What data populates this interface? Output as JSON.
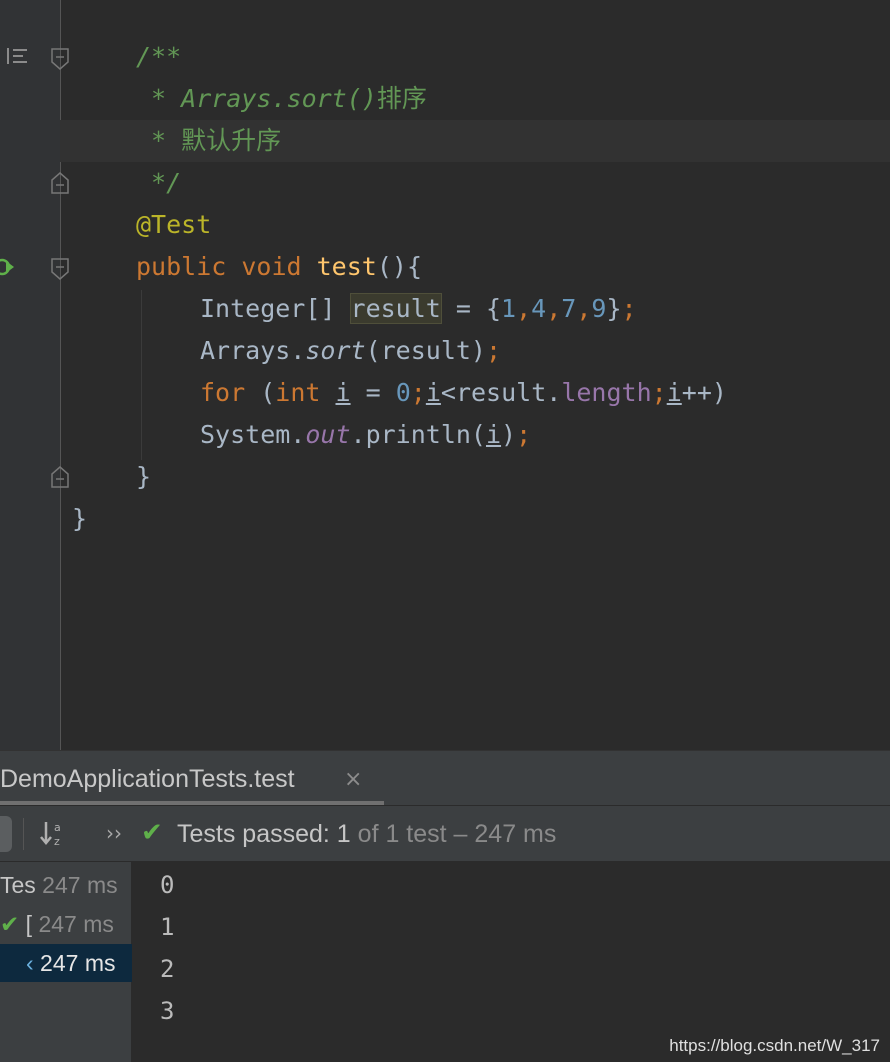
{
  "editor": {
    "lines": [
      {
        "id": "l1",
        "tokens": [
          {
            "t": "/**",
            "c": "cmt"
          }
        ]
      },
      {
        "id": "l2",
        "tokens": [
          {
            "t": " * Arrays.sort()",
            "c": "cmt"
          },
          {
            "t": "排序",
            "c": "cmt-cn"
          }
        ]
      },
      {
        "id": "l3",
        "tokens": [
          {
            "t": " * ",
            "c": "cmt"
          },
          {
            "t": "默认升序",
            "c": "cmt-cn"
          }
        ]
      },
      {
        "id": "l4",
        "tokens": [
          {
            "t": " */",
            "c": "cmt"
          }
        ]
      },
      {
        "id": "l5",
        "tokens": [
          {
            "t": "@Test",
            "c": "ann"
          }
        ]
      },
      {
        "id": "l6",
        "tokens": [
          {
            "t": "public ",
            "c": "kw"
          },
          {
            "t": "void ",
            "c": "kw"
          },
          {
            "t": "test",
            "c": "fn"
          },
          {
            "t": "(){",
            "c": ""
          }
        ]
      },
      {
        "id": "l7",
        "tokens": [
          {
            "t": "Integer[] ",
            "c": ""
          },
          {
            "t": "result",
            "c": "hl"
          },
          {
            "t": " = {",
            "c": ""
          },
          {
            "t": "1",
            "c": "num"
          },
          {
            "t": ",",
            "c": "semi"
          },
          {
            "t": "4",
            "c": "num"
          },
          {
            "t": ",",
            "c": "semi"
          },
          {
            "t": "7",
            "c": "num"
          },
          {
            "t": ",",
            "c": "semi"
          },
          {
            "t": "9",
            "c": "num"
          },
          {
            "t": "}",
            "c": ""
          },
          {
            "t": ";",
            "c": "semi"
          }
        ]
      },
      {
        "id": "l8",
        "tokens": [
          {
            "t": "Arrays.",
            "c": ""
          },
          {
            "t": "sort",
            "c": "ital"
          },
          {
            "t": "(result)",
            "c": ""
          },
          {
            "t": ";",
            "c": "semi"
          }
        ]
      },
      {
        "id": "l9",
        "tokens": [
          {
            "t": "for ",
            "c": "kw"
          },
          {
            "t": "(",
            "c": ""
          },
          {
            "t": "int ",
            "c": "kw"
          },
          {
            "t": "i",
            "c": "ul"
          },
          {
            "t": " = ",
            "c": ""
          },
          {
            "t": "0",
            "c": "num"
          },
          {
            "t": ";",
            "c": "semi"
          },
          {
            "t": "i",
            "c": "ul"
          },
          {
            "t": "<result.",
            "c": ""
          },
          {
            "t": "length",
            "c": "fld"
          },
          {
            "t": ";",
            "c": "semi"
          },
          {
            "t": "i",
            "c": "ul"
          },
          {
            "t": "++)",
            "c": ""
          }
        ]
      },
      {
        "id": "l10",
        "tokens": [
          {
            "t": "System.",
            "c": ""
          },
          {
            "t": "out",
            "c": "ital-fld"
          },
          {
            "t": ".println(",
            "c": ""
          },
          {
            "t": "i",
            "c": "ul"
          },
          {
            "t": ")",
            "c": ""
          },
          {
            "t": ";",
            "c": "semi"
          }
        ]
      },
      {
        "id": "l11",
        "tokens": [
          {
            "t": "}",
            "c": ""
          }
        ]
      },
      {
        "id": "l12",
        "tokens": [
          {
            "t": "}",
            "c": ""
          }
        ]
      }
    ]
  },
  "run_panel": {
    "tab_title": "DemoApplicationTests.test",
    "tab_close": "×",
    "sort_icon": "↓ᵃ𝓏",
    "more_icon": "››",
    "status": {
      "check": "✔",
      "passed_label": "Tests passed: 1",
      "rest": " of 1 test – 247 ms"
    },
    "tree": [
      {
        "name": "Tes",
        "time": " 247 ms",
        "check": "",
        "selected": false
      },
      {
        "name": " [",
        "time": " 247 ms",
        "check": "✔",
        "selected": false
      },
      {
        "name": "",
        "time": " 247 ms",
        "check": "",
        "selected": true
      }
    ],
    "output": [
      "0",
      "1",
      "2",
      "3"
    ]
  },
  "watermark": "https://blog.csdn.net/W_317",
  "colors": {
    "background": "#2b2b2b",
    "comment": "#629755",
    "keyword": "#cc7832",
    "annotation": "#bbb529",
    "function": "#ffc66d",
    "number": "#6897bb",
    "field": "#9876aa",
    "pass_green": "#5fb04a"
  }
}
